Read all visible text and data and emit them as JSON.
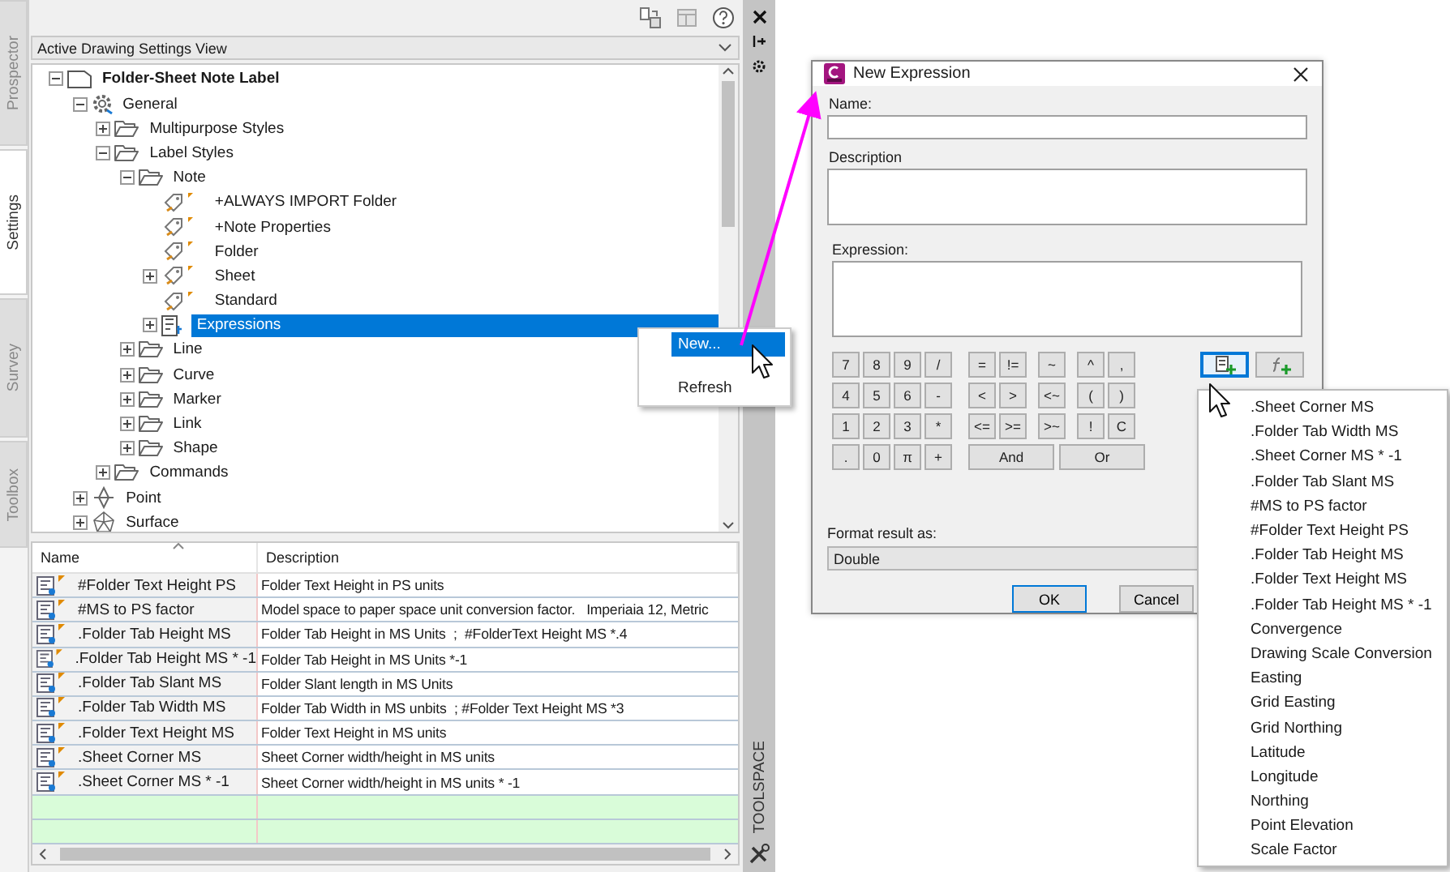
{
  "side_tabs": [
    {
      "label": "Prospector",
      "selected": false
    },
    {
      "label": "Settings",
      "selected": true
    },
    {
      "label": "Survey",
      "selected": false
    },
    {
      "label": "Toolbox",
      "selected": false
    }
  ],
  "view_select": {
    "value": "Active Drawing Settings View"
  },
  "tree": {
    "items": [
      {
        "label": "Folder-Sheet Note Label",
        "kind": "document",
        "expanded": true,
        "selected": false,
        "children": [
          {
            "label": "General",
            "kind": "gear",
            "expanded": true,
            "selected": false,
            "children": [
              {
                "label": "Multipurpose Styles",
                "kind": "folder",
                "expanded": false,
                "selected": false
              },
              {
                "label": "Label Styles",
                "kind": "folder",
                "expanded": true,
                "selected": false,
                "children": [
                  {
                    "label": "Note",
                    "kind": "folder",
                    "expanded": true,
                    "selected": false,
                    "children": [
                      {
                        "label": "+ALWAYS IMPORT Folder",
                        "kind": "style",
                        "selected": false
                      },
                      {
                        "label": "+Note Properties",
                        "kind": "style",
                        "selected": false
                      },
                      {
                        "label": "Folder",
                        "kind": "style",
                        "selected": false
                      },
                      {
                        "label": "Sheet",
                        "kind": "style",
                        "expanded": false,
                        "selected": false
                      },
                      {
                        "label": "Standard",
                        "kind": "style",
                        "selected": false
                      },
                      {
                        "label": "Expressions",
                        "kind": "expressions",
                        "expanded": false,
                        "selected": true
                      }
                    ]
                  },
                  {
                    "label": "Line",
                    "kind": "folder",
                    "expanded": false,
                    "selected": false
                  },
                  {
                    "label": "Curve",
                    "kind": "folder",
                    "expanded": false,
                    "selected": false
                  },
                  {
                    "label": "Marker",
                    "kind": "folder",
                    "expanded": false,
                    "selected": false
                  },
                  {
                    "label": "Link",
                    "kind": "folder",
                    "expanded": false,
                    "selected": false
                  },
                  {
                    "label": "Shape",
                    "kind": "folder",
                    "expanded": false,
                    "selected": false
                  }
                ]
              },
              {
                "label": "Commands",
                "kind": "folder",
                "expanded": false,
                "selected": false
              }
            ]
          },
          {
            "label": "Point",
            "kind": "point",
            "expanded": false,
            "selected": false
          },
          {
            "label": "Surface",
            "kind": "surface",
            "expanded": false,
            "selected": false
          }
        ]
      }
    ]
  },
  "context_menu": {
    "items": [
      {
        "label": "New...",
        "selected": true
      },
      {
        "label": "Refresh",
        "selected": false
      }
    ]
  },
  "table": {
    "columns": [
      "Name",
      "Description"
    ],
    "rows": [
      {
        "name": "#Folder Text Height PS",
        "description": "Folder Text Height in PS units"
      },
      {
        "name": "#MS to PS factor",
        "description": "Model space to paper space unit conversion factor.   Imperiaia 12, Metric"
      },
      {
        "name": ".Folder Tab Height MS",
        "description": "Folder Tab Height in MS Units  ;  #FolderText Height MS *.4"
      },
      {
        "name": ".Folder Tab Height MS * -1",
        "description": "Folder Tab Height in MS Units *-1"
      },
      {
        "name": ".Folder Tab Slant MS",
        "description": "Folder Slant length in MS Units"
      },
      {
        "name": ".Folder Tab Width MS",
        "description": "Folder Tab Width in MS unbits  ; #Folder Text Height MS *3"
      },
      {
        "name": ".Folder Text Height MS",
        "description": "Folder Text Height in MS units"
      },
      {
        "name": ".Sheet Corner MS",
        "description": "Sheet Corner width/height in MS units"
      },
      {
        "name": ".Sheet Corner MS * -1",
        "description": "Sheet Corner width/height in MS units * -1"
      }
    ],
    "blank_rows": [
      {
        "kind": "new"
      },
      {
        "kind": "new"
      }
    ]
  },
  "toolspace_label": "TOOLSPACE",
  "dialog": {
    "title": "New Expression",
    "name_label": "Name:",
    "description_label": "Description",
    "expression_label": "Expression:",
    "keypad": [
      [
        [
          "7",
          "8",
          "9",
          "/"
        ],
        [
          "=",
          "!="
        ],
        [
          "~"
        ],
        [
          "^",
          ","
        ]
      ],
      [
        [
          "4",
          "5",
          "6",
          "-"
        ],
        [
          "<",
          ">"
        ],
        [
          "<~"
        ],
        [
          "(",
          ")"
        ]
      ],
      [
        [
          "1",
          "2",
          "3",
          "*"
        ],
        [
          "<=",
          ">="
        ],
        [
          ">~"
        ],
        [
          "!",
          "C"
        ]
      ],
      [
        [
          ".",
          "0",
          "π",
          "+"
        ],
        [
          "And",
          "Or"
        ]
      ]
    ],
    "tool_buttons": [
      {
        "kind": "insert-property",
        "selected": true
      },
      {
        "kind": "insert-function",
        "selected": false
      }
    ],
    "format_label": "Format result as:",
    "format_value": "Double",
    "buttons": [
      "OK",
      "Cancel"
    ]
  },
  "property_menu": {
    "items": [
      ".Sheet Corner MS",
      ".Folder Tab Width MS",
      ".Sheet Corner MS * -1",
      ".Folder Tab Slant MS",
      "#MS to PS factor",
      "#Folder Text Height PS",
      ".Folder Tab Height MS",
      ".Folder Text Height MS",
      ".Folder Tab Height MS * -1",
      "Convergence",
      "Drawing Scale Conversion",
      "Easting",
      "Grid Easting",
      "Grid Northing",
      "Latitude",
      "Longitude",
      "Northing",
      "Point Elevation",
      "Scale Factor"
    ]
  }
}
